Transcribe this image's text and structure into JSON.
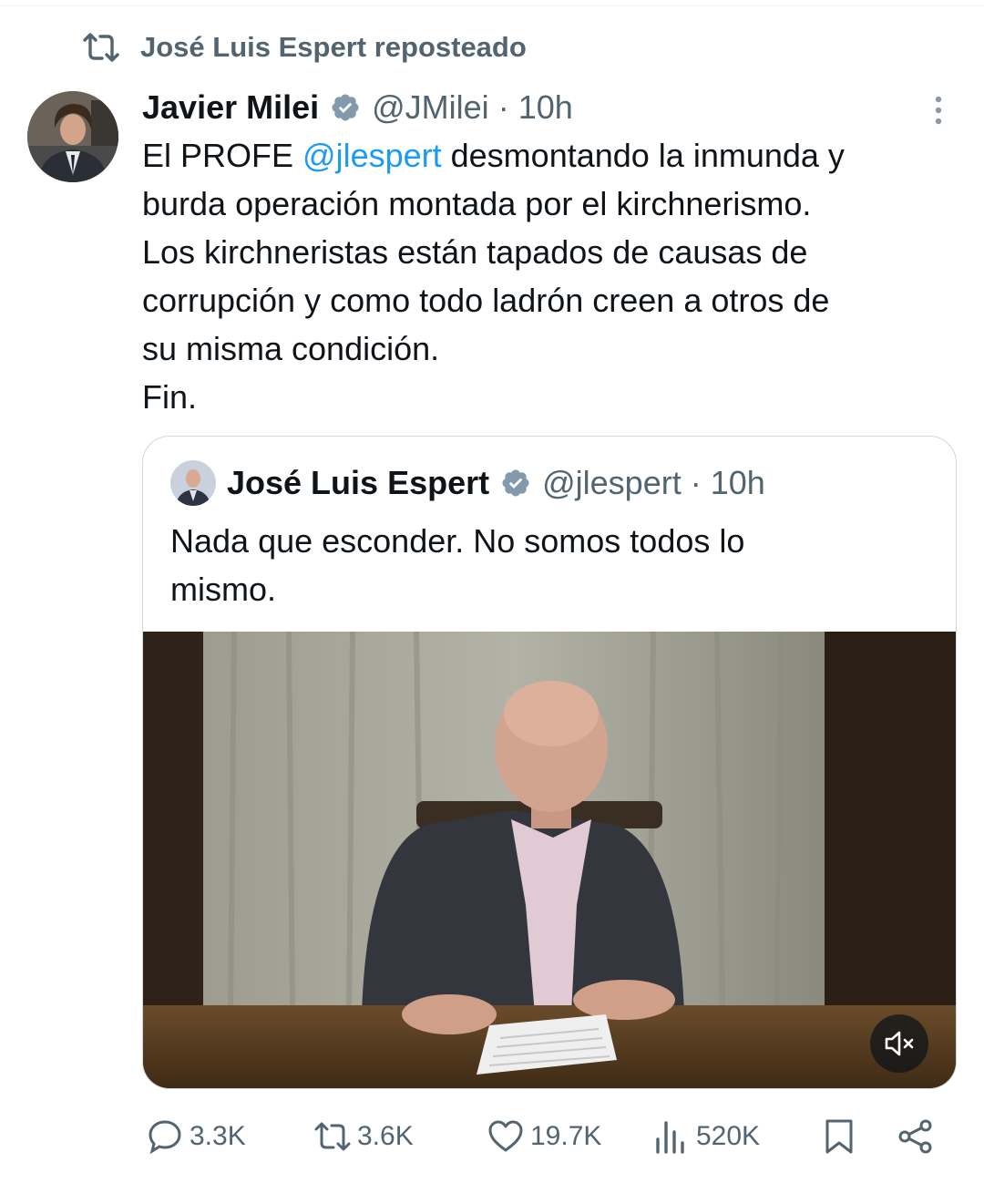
{
  "repost": {
    "icon": "repost-icon",
    "label": "José Luis Espert reposteado"
  },
  "tweet": {
    "author_name": "Javier Milei",
    "handle": "@JMilei",
    "separator": "·",
    "time": "10h",
    "verified_icon": "verified-badge-icon",
    "text_line1_before": "El PROFE ",
    "mention": "@jlespert",
    "text_line1_after": " desmontando la inmunda y",
    "text_line2": "burda operación montada por el kirchnerismo.",
    "text_line3": "Los kirchneristas están tapados de causas de",
    "text_line4": "corrupción y como todo ladrón creen a otros de",
    "text_line5": "su misma condición.",
    "text_line6": "Fin."
  },
  "quote": {
    "author_name": "José Luis Espert",
    "handle": "@jlespert",
    "separator": "·",
    "time": "10h",
    "text_line1": "Nada que esconder. No somos todos lo",
    "text_line2": "mismo.",
    "media": {
      "type": "video",
      "muted_icon": "volume-muted-icon"
    }
  },
  "actions": {
    "replies": "3.3K",
    "reposts": "3.6K",
    "likes": "19.7K",
    "views": "520K"
  },
  "colors": {
    "accent": "#1d9bf0",
    "secondary_text": "#536471",
    "primary_text": "#0f1419",
    "border": "#cfd9de"
  }
}
